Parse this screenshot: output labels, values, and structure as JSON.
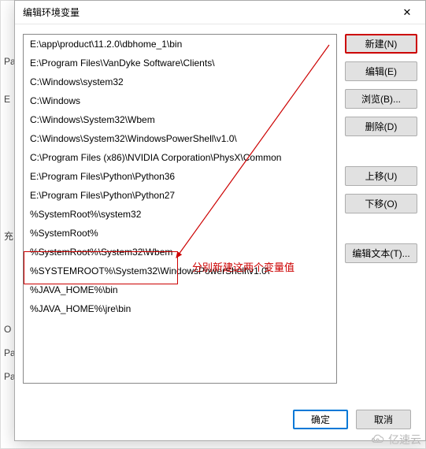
{
  "dialog": {
    "title": "编辑环境变量",
    "close_icon": "✕"
  },
  "list": {
    "items": [
      "E:\\app\\product\\11.2.0\\dbhome_1\\bin",
      "E:\\Program Files\\VanDyke Software\\Clients\\",
      "C:\\Windows\\system32",
      "C:\\Windows",
      "C:\\Windows\\System32\\Wbem",
      "C:\\Windows\\System32\\WindowsPowerShell\\v1.0\\",
      "C:\\Program Files (x86)\\NVIDIA Corporation\\PhysX\\Common",
      "E:\\Program Files\\Python\\Python36",
      "E:\\Program Files\\Python\\Python27",
      "%SystemRoot%\\system32",
      "%SystemRoot%",
      "%SystemRoot%\\System32\\Wbem",
      "%SYSTEMROOT%\\System32\\WindowsPowerShell\\v1.0\\",
      "%JAVA_HOME%\\bin",
      "%JAVA_HOME%\\jre\\bin"
    ]
  },
  "buttons": {
    "new": "新建(N)",
    "edit": "编辑(E)",
    "browse": "浏览(B)...",
    "delete": "删除(D)",
    "move_up": "上移(U)",
    "move_down": "下移(O)",
    "edit_text": "编辑文本(T)..."
  },
  "footer": {
    "ok": "确定",
    "cancel": "取消"
  },
  "annotation": {
    "text": "分别新建这两个变量值"
  },
  "bg": {
    "t1": "Pa",
    "t2": "E",
    "t3": "充",
    "t4": "O",
    "t5": "Pa",
    "t6": "Pa"
  },
  "watermark": {
    "text": "亿速云"
  }
}
